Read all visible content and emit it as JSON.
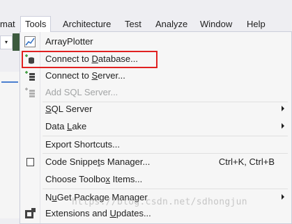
{
  "menubar": {
    "items": [
      {
        "label": "mat"
      },
      {
        "label": "Tools"
      },
      {
        "label": "Architecture"
      },
      {
        "label": "Test"
      },
      {
        "label": "Analyze"
      },
      {
        "label": "Window"
      },
      {
        "label": "Help"
      }
    ]
  },
  "tools_menu": {
    "items": [
      {
        "label": "ArrayPlotter",
        "icon": "chart-icon"
      },
      {
        "label": "Connect to Database...",
        "icon": "database-connect-icon",
        "highlighted": true
      },
      {
        "label": "Connect to Server...",
        "icon": "server-connect-icon"
      },
      {
        "label": "Add SQL Server...",
        "icon": "add-sql-server-icon",
        "disabled": true
      },
      {
        "label": "SQL Server",
        "submenu": true
      },
      {
        "label": "Data Lake",
        "submenu": true
      },
      {
        "label": "Export Shortcuts..."
      },
      {
        "label": "Code Snippets Manager...",
        "shortcut": "Ctrl+K, Ctrl+B",
        "icon": "checkbox-icon"
      },
      {
        "label": "Choose Toolbox Items..."
      },
      {
        "label": "NuGet Package Manager",
        "submenu": true
      },
      {
        "label": "Extensions and Updates...",
        "icon": "extensions-icon"
      }
    ]
  },
  "watermark": "https://blog.csdn.net/sdhongjun",
  "colors": {
    "highlight_border": "#e02020",
    "toolbar_green": "#3c5a3e"
  }
}
